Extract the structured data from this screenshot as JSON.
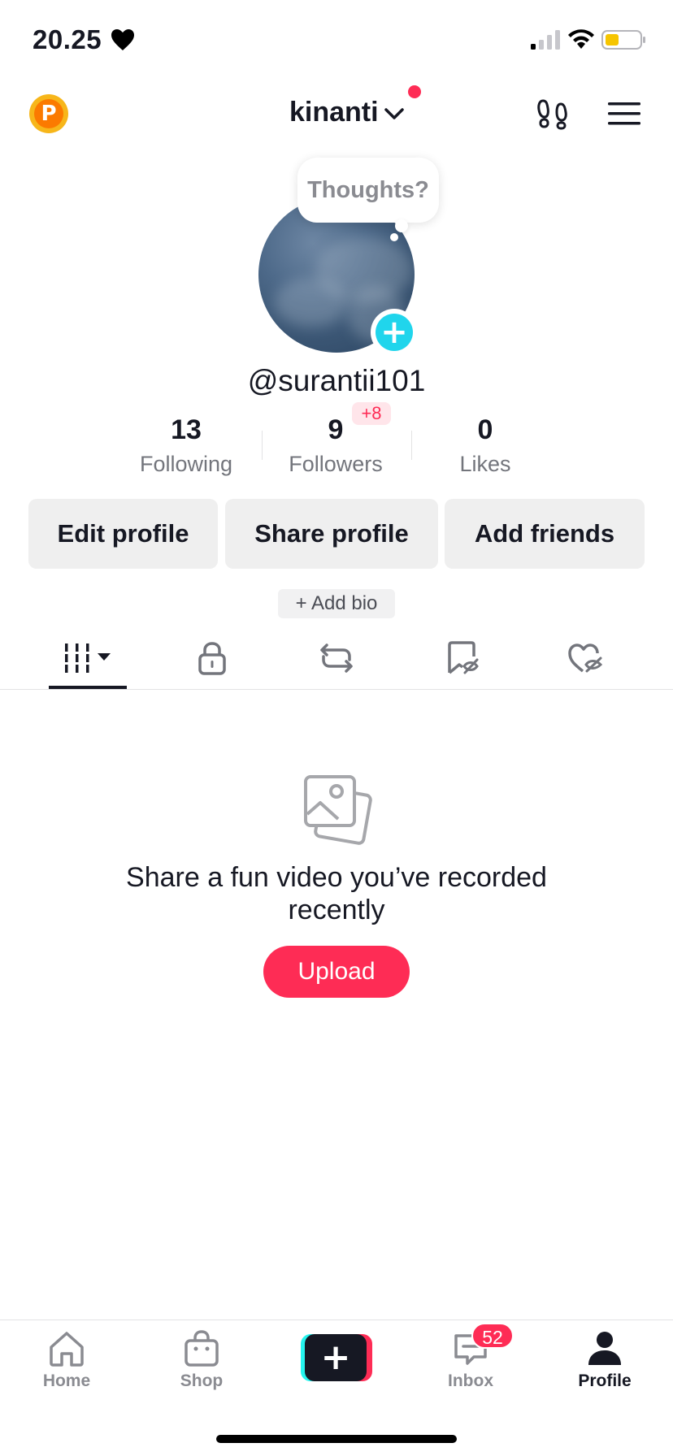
{
  "status_bar": {
    "time": "20.25",
    "battery_color": "#f6c500"
  },
  "header": {
    "account_name": "kinanti",
    "coin_letter": "P",
    "icons": [
      "coin-icon",
      "chevron-down-icon",
      "footprint-icon",
      "menu-icon"
    ]
  },
  "profile": {
    "thought_placeholder": "Thoughts?",
    "username": "@surantii101",
    "stats": {
      "following_value": "13",
      "following_label": "Following",
      "followers_value": "9",
      "followers_label": "Followers",
      "followers_badge": "+8",
      "likes_value": "0",
      "likes_label": "Likes"
    },
    "buttons": {
      "edit": "Edit profile",
      "share": "Share profile",
      "add_friends": "Add friends"
    },
    "add_bio": "+ Add bio"
  },
  "tabs": [
    {
      "name": "videos",
      "icon": "grid-icon",
      "selected": true
    },
    {
      "name": "private",
      "icon": "lock-icon",
      "selected": false
    },
    {
      "name": "reposts",
      "icon": "repost-icon",
      "selected": false
    },
    {
      "name": "favorites",
      "icon": "bookmark-hidden-icon",
      "selected": false
    },
    {
      "name": "liked",
      "icon": "heart-hidden-icon",
      "selected": false
    }
  ],
  "empty_state": {
    "icon": "photos-icon",
    "message": "Share a fun video you’ve recorded recently",
    "upload_label": "Upload"
  },
  "bottom_nav": {
    "home": "Home",
    "shop": "Shop",
    "create": "+",
    "inbox": "Inbox",
    "inbox_badge": "52",
    "profile": "Profile"
  },
  "colors": {
    "accent": "#fe2c55",
    "cyan": "#25f4ee",
    "text": "#161823"
  }
}
